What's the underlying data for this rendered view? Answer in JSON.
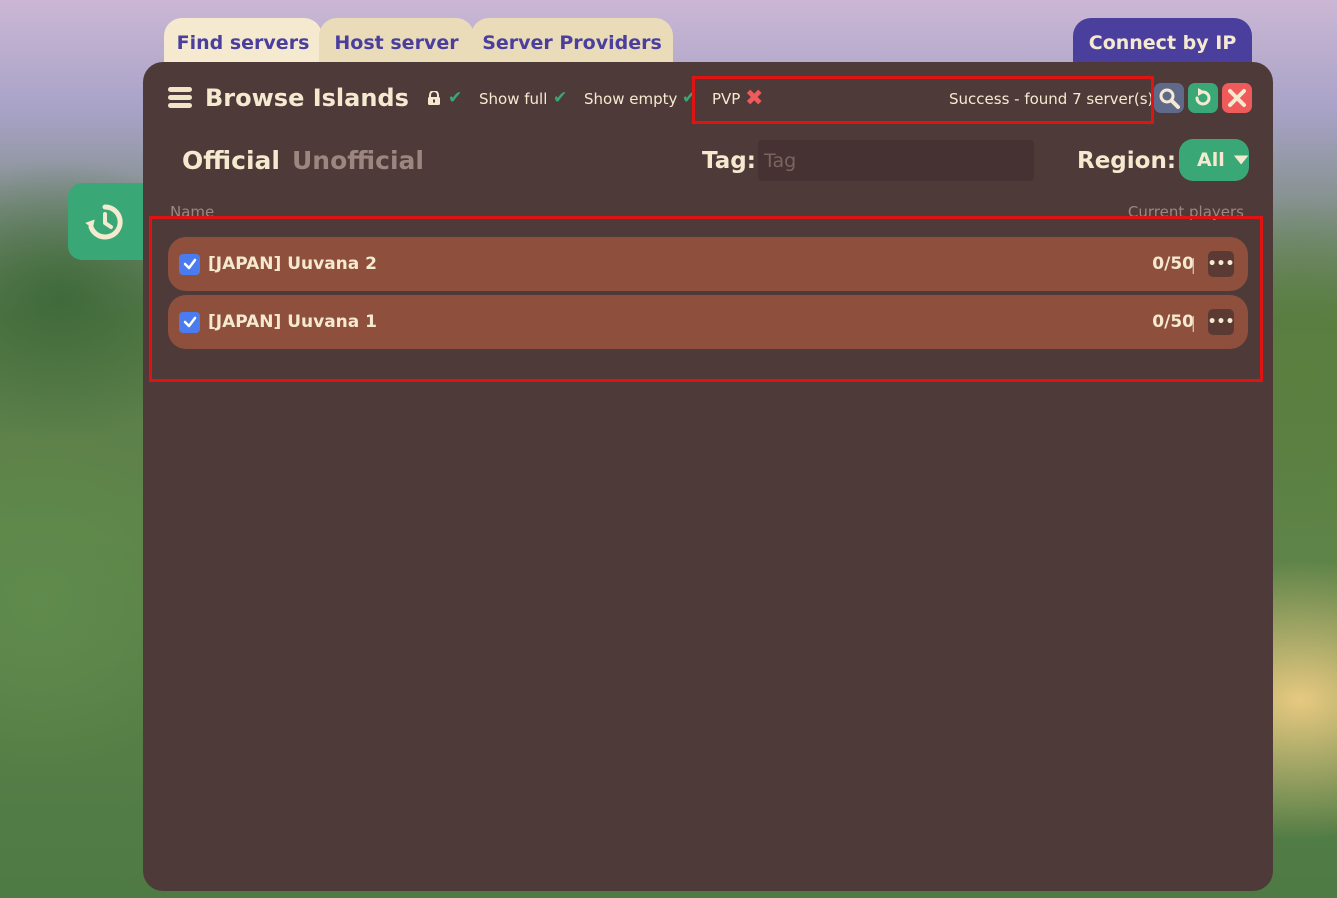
{
  "tabs": {
    "find": "Find servers",
    "host": "Host server",
    "providers": "Server Providers"
  },
  "connect_button": "Connect by IP",
  "panel": {
    "title": "Browse Islands",
    "filters": {
      "show_full": "Show full",
      "show_empty": "Show empty",
      "pvp": "PVP"
    },
    "status": "Success - found 7 server(s)",
    "subtabs": {
      "official": "Official",
      "unofficial": "Unofficial"
    },
    "tag_label": "Tag:",
    "tag_placeholder": "Tag",
    "region_label": "Region:",
    "region_value": "All",
    "columns": {
      "name": "Name",
      "players": "Current players"
    },
    "servers": [
      {
        "name": "[JAPAN] Uuvana 2",
        "players": "0/50"
      },
      {
        "name": "[JAPAN] Uuvana 1",
        "players": "0/50"
      }
    ]
  },
  "colors": {
    "panel": "#4f3a3a",
    "row": "#8e503d",
    "accent_green": "#3aa876",
    "accent_purple": "#4b3f9e",
    "danger": "#ef5a5a",
    "highlight": "#e01313"
  }
}
